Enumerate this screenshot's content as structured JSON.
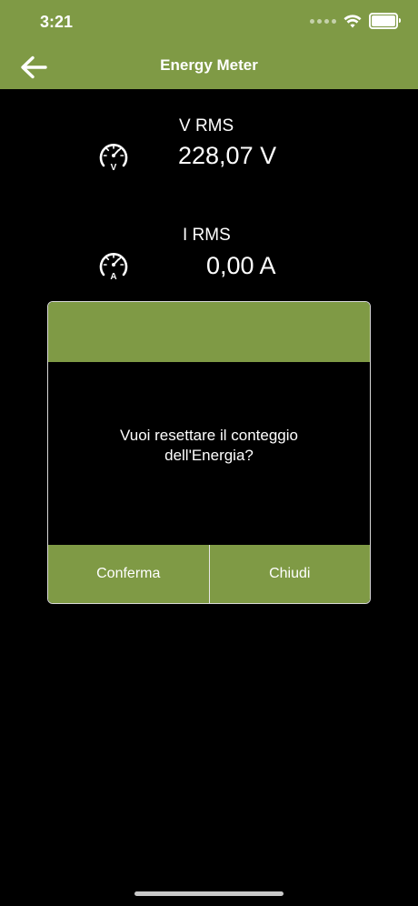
{
  "status_bar": {
    "time": "3:21"
  },
  "nav": {
    "title": "Energy Meter",
    "back_icon": "arrow-left-icon"
  },
  "meters": {
    "voltage": {
      "label": "V RMS",
      "value": "228,07 V",
      "icon_letter": "V",
      "icon": "voltmeter-gauge-icon"
    },
    "current": {
      "label": "I RMS",
      "value": "0,00 A",
      "icon_letter": "A",
      "icon": "ammeter-gauge-icon"
    }
  },
  "dialog": {
    "message": "Vuoi resettare il conteggio\ndell'Energia?",
    "confirm_label": "Conferma",
    "close_label": "Chiudi"
  },
  "colors": {
    "accent": "#7f9a45",
    "background": "#000000",
    "text": "#ffffff"
  }
}
